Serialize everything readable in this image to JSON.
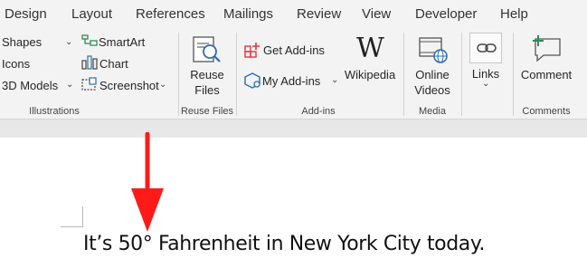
{
  "tabs": [
    "Design",
    "Layout",
    "References",
    "Mailings",
    "Review",
    "View",
    "Developer",
    "Help"
  ],
  "illustrations": {
    "shapes": "Shapes",
    "icons": "Icons",
    "models": "3D Models",
    "smartart": "SmartArt",
    "chart": "Chart",
    "screenshot": "Screenshot",
    "group_label": "Illustrations"
  },
  "reuse_files": {
    "label_line1": "Reuse",
    "label_line2": "Files",
    "group_label": "Reuse Files"
  },
  "addins": {
    "get": "Get Add-ins",
    "my": "My Add-ins",
    "wikipedia": "Wikipedia",
    "group_label": "Add-ins"
  },
  "media": {
    "label_line1": "Online",
    "label_line2": "Videos",
    "group_label": "Media"
  },
  "links": {
    "label": "Links"
  },
  "comments": {
    "label": "Comment",
    "group_label": "Comments"
  },
  "document": {
    "text": "It’s 50° Fahrenheit in New York City today."
  },
  "colors": {
    "ribbon": "#f3f3f3",
    "accent_red": "#e8343b",
    "accent_blue": "#2b6cb0",
    "accent_green": "#2e8b57",
    "arrow": "#ff1a1a"
  }
}
